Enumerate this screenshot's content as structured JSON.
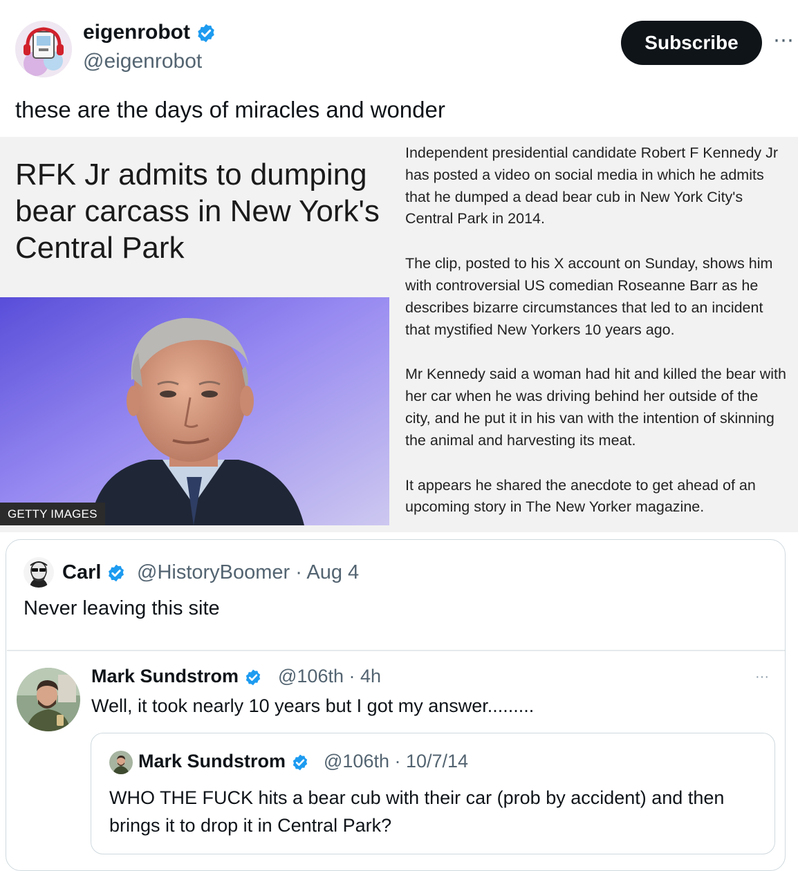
{
  "author": {
    "display_name": "eigenrobot",
    "handle": "@eigenrobot",
    "subscribe_label": "Subscribe",
    "more_label": "⋯"
  },
  "tweet_text": "these are the days of miracles and wonder",
  "article": {
    "headline": "RFK Jr admits to dumping bear carcass in New York's Central Park",
    "photo_credit": "GETTY IMAGES",
    "paragraphs": [
      "Independent presidential candidate Robert F Kennedy Jr has posted a video on social media in which he admits that he dumped a dead bear cub in New York City's Central Park in 2014.",
      "The clip, posted to his X account on Sunday, shows him with controversial US comedian Roseanne Barr as he describes bizarre circumstances that led to an incident that mystified New Yorkers 10 years ago.",
      "Mr Kennedy said a woman had hit and killed the bear with her car when he was driving behind her outside of the city, and he put it in his van with the intention of skinning the animal and harvesting its meat.",
      "It appears he shared the anecdote to get ahead of an upcoming story in The New Yorker magazine."
    ]
  },
  "quoted": {
    "name": "Carl",
    "meta": "@HistoryBoomer · Aug 4",
    "text": "Never leaving this site"
  },
  "reply": {
    "name": "Mark Sundstrom",
    "meta": "@106th · 4h",
    "text": "Well, it took nearly 10 years but I got my answer.........",
    "more_label": "···"
  },
  "inner_quote": {
    "name": "Mark Sundstrom",
    "meta": "@106th · 10/7/14",
    "text": "WHO THE FUCK hits a bear cub with their car (prob by accident) and then brings it to drop it in Central Park?"
  },
  "colors": {
    "verified": "#1d9bf0",
    "subscribe_bg": "#0f1419",
    "secondary_text": "#536471",
    "article_bg": "#f2f2f2"
  }
}
